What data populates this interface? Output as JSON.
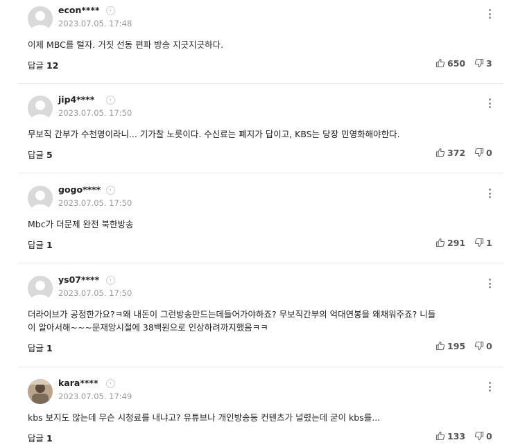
{
  "comments": [
    {
      "nickname": "econ****",
      "date": "2023.07.05. 17:48",
      "text": [
        "이제 MBC를 털자. 거짓 선동 편파 방송 지긋지긋하다."
      ],
      "reply_label": "답글",
      "reply_count": "12",
      "likes": "650",
      "dislikes": "3",
      "avatar": "default-avatar"
    },
    {
      "nickname": "jip4****",
      "date": "2023.07.05. 17:50",
      "text": [
        "무보직 간부가 수천명이라니... 기가찰 노릇이다. 수신료는 폐지가 답이고, KBS는 당장 민영화해야한다."
      ],
      "reply_label": "답글",
      "reply_count": "5",
      "likes": "372",
      "dislikes": "0",
      "avatar": "default-avatar"
    },
    {
      "nickname": "gogo****",
      "date": "2023.07.05. 17:50",
      "text": [
        "Mbc가 더문제 완전 북한방송"
      ],
      "reply_label": "답글",
      "reply_count": "1",
      "likes": "291",
      "dislikes": "1",
      "avatar": "default-avatar"
    },
    {
      "nickname": "ys07****",
      "date": "2023.07.05. 17:50",
      "text": [
        "더라이브가 공정한가요?ㅋ왜 내돈이 그런방송만드는데들어가야하죠? 무보직간부의 억대연봉을 왜채워주죠? 니들",
        "이 알아서해~~~문재앙시절에 38백원으로 인상하려까지했음ㅋㅋ"
      ],
      "reply_label": "답글",
      "reply_count": "1",
      "likes": "195",
      "dislikes": "0",
      "avatar": "default-avatar"
    },
    {
      "nickname": "kara****",
      "date": "2023.07.05. 17:49",
      "text": [
        "kbs 보지도 않는데 무슨 시청료를 내냐고? 유튜브나 개인방송등 컨텐츠가 널렸는데 굳이 kbs를..."
      ],
      "reply_label": "답글",
      "reply_count": "1",
      "likes": "133",
      "dislikes": "0",
      "avatar": "photo-avatar"
    }
  ],
  "icons": {
    "profile_more": "chevron-right-icon",
    "menu": "kebab-menu-icon",
    "like": "thumbs-up-icon",
    "dislike": "thumbs-down-icon"
  },
  "colors": {
    "text": "#222222",
    "meta": "#999999",
    "divider": "#ebebeb",
    "vote": "#555555"
  }
}
